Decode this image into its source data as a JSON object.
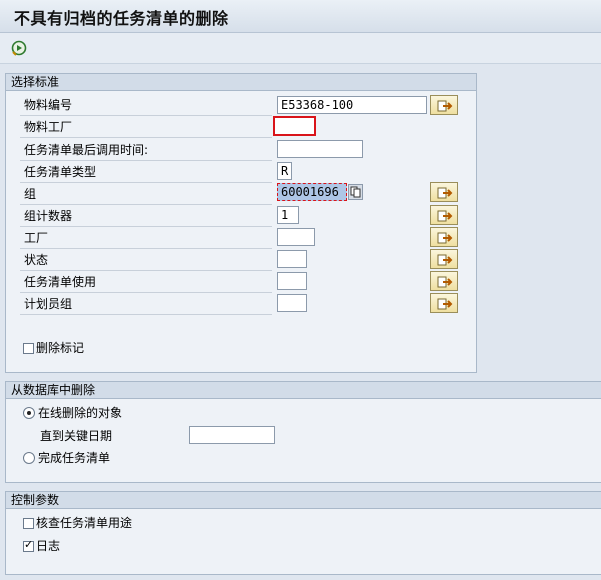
{
  "window": {
    "title": "不具有归档的任务清单的删除"
  },
  "toolbar": {
    "execute_icon": "execute-icon"
  },
  "selection": {
    "title": "选择标准",
    "material_label": "物料编号",
    "material_value": "E53368-100",
    "plant_label": "物料工厂",
    "plant_value": "",
    "last_used_label": "任务清单最后调用时间:",
    "last_used_value": "",
    "type_label": "任务清单类型",
    "type_value": "R",
    "group_label": "组",
    "group_value": "60001696",
    "counter_label": "组计数器",
    "counter_value": "1",
    "plant2_label": "工厂",
    "plant2_value": "",
    "status_label": "状态",
    "status_value": "",
    "usage_label": "任务清单使用",
    "usage_value": "",
    "planner_label": "计划员组",
    "planner_value": "",
    "deletion_flag_label": "删除标记",
    "deletion_flag_checked": false
  },
  "delete_db": {
    "title": "从数据库中删除",
    "online_label": "在线删除的对象",
    "online_selected": true,
    "key_date_label": "直到关键日期",
    "key_date_value": "",
    "complete_label": "完成任务清单",
    "complete_selected": false
  },
  "control": {
    "title": "控制参数",
    "check_usage_label": "核查任务清单用途",
    "check_usage_checked": false,
    "log_label": "日志",
    "log_checked": true
  },
  "colors": {
    "error_border": "#d9141a",
    "focus_bg": "#aec6e6"
  }
}
